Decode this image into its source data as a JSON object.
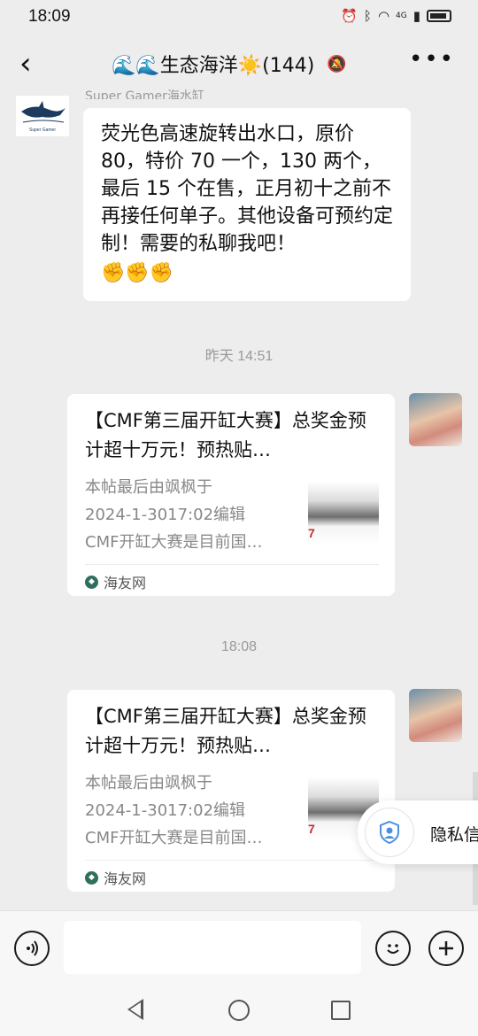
{
  "status_bar": {
    "time": "18:09",
    "network": "4G"
  },
  "header": {
    "back_icon": "chevron-left-icon",
    "title": "🌊🌊生态海洋☀️(144)",
    "mute_icon": "bell-off-icon",
    "more_icon": "more-icon"
  },
  "messages": {
    "first": {
      "sender_name": "Super Gamer海水缸",
      "avatar_label": "Super Gamer",
      "text": "荧光色高速旋转出水口，原价80，特价 70 一个，130 两个，最后 15 个在售，正月初十之前不再接任何单子。其他设备可预约定制！需要的私聊我吧！",
      "emojis": "✊✊✊"
    },
    "timestamp1": "昨天 14:51",
    "card1": {
      "title": "【CMF第三届开缸大赛】总奖金预计超十万元！预热贴…",
      "desc_lines": [
        "本帖最后由飒枫于",
        "2024-1-3017:02编辑",
        "CMF开缸大赛是目前国…"
      ],
      "thumb_text": "7",
      "source": "海友网"
    },
    "timestamp2": "18:08",
    "card2": {
      "title": "【CMF第三届开缸大赛】总奖金预计超十万元！预热贴…",
      "desc_lines": [
        "本帖最后由飒枫于",
        "2024-1-3017:02编辑",
        "CMF开缸大赛是目前国…"
      ],
      "thumb_text": "7",
      "source": "海友网"
    }
  },
  "privacy_popup": {
    "label": "隐私信",
    "icon": "shield-person-icon"
  },
  "input_bar": {
    "voice_icon": "voice-icon",
    "placeholder": "",
    "emoji_icon": "smiley-icon",
    "plus_icon": "plus-icon"
  },
  "nav_bar": {
    "back": "nav-back-icon",
    "home": "nav-home-icon",
    "recent": "nav-recent-icon"
  },
  "colors": {
    "background": "#ededed",
    "bubble": "#ffffff",
    "accent_blue": "#4a8fe0"
  }
}
